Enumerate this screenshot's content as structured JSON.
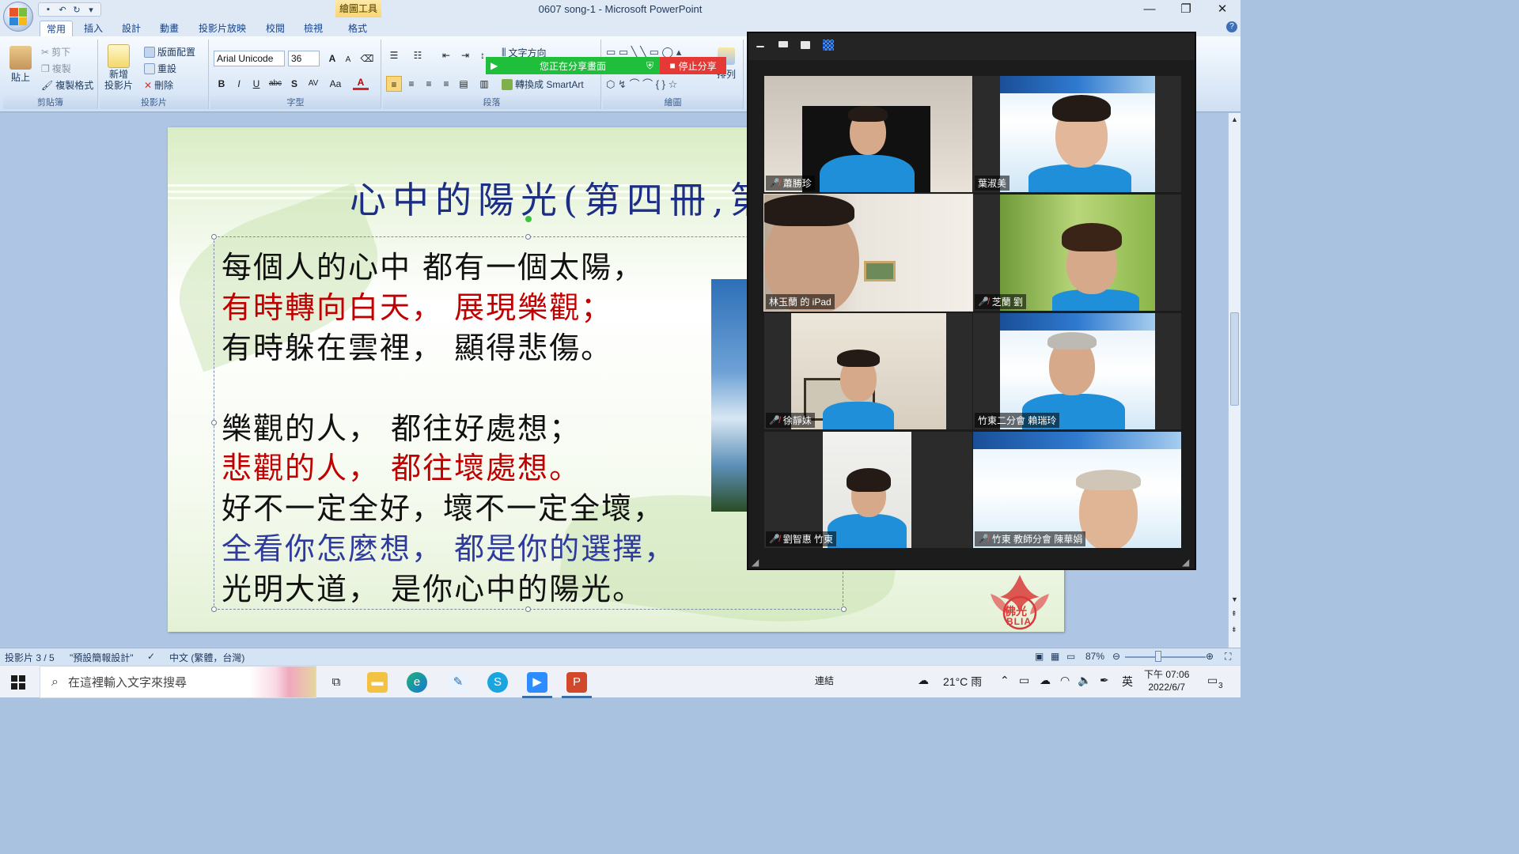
{
  "window": {
    "title": "0607 song-1 - Microsoft PowerPoint",
    "contextual_tab": "繪圖工具",
    "controls": {
      "minimize": "—",
      "restore": "❐",
      "close": "✕"
    }
  },
  "quick_access": {
    "save": "▪",
    "undo": "↶",
    "redo": "↻",
    "more": "▾"
  },
  "ribbon_tabs": [
    "常用",
    "插入",
    "設計",
    "動畫",
    "投影片放映",
    "校閱",
    "檢視",
    "格式"
  ],
  "ribbon": {
    "clipboard": {
      "paste": "貼上",
      "cut": "剪下",
      "copy": "複製",
      "format_painter": "複製格式",
      "label": "剪貼簿"
    },
    "slides": {
      "new_slide": "新增\n投影片",
      "layout": "版面配置",
      "reset": "重設",
      "delete": "刪除",
      "label": "投影片"
    },
    "font": {
      "family": "Arial Unicode",
      "size": "36",
      "label": "字型",
      "grow": "A",
      "shrink": "A",
      "clear": "⌫",
      "bold": "B",
      "italic": "I",
      "underline": "U",
      "strike": "abc",
      "shadow": "S",
      "spacing": "AV",
      "case": "Aa",
      "color": "A"
    },
    "paragraph": {
      "text_direction": "文字方向",
      "smartart": "轉換成 SmartArt",
      "label": "段落"
    },
    "drawing": {
      "arrange": "排列",
      "label": "繪圖"
    }
  },
  "share_banner": {
    "status": "您正在分享畫面",
    "stop": "停止分享"
  },
  "slide": {
    "title": "心中的陽光(第四冊,第",
    "lines": [
      {
        "text": "每個人的心中 都有一個太陽，",
        "color": "#111111"
      },
      {
        "text": "有時轉向白天， 展現樂觀；",
        "color": "#c00000"
      },
      {
        "text": "有時躲在雲裡， 顯得悲傷。",
        "color": "#111111"
      },
      {
        "text": "樂觀的人， 都往好處想；",
        "color": "#111111"
      },
      {
        "text": "悲觀的人， 都往壞處想。",
        "color": "#c00000"
      },
      {
        "text": "好不一定全好，壞不一定全壞，",
        "color": "#111111"
      },
      {
        "text": "全看你怎麼想， 都是你的選擇，",
        "color": "#2f3a9e"
      },
      {
        "text": "光明大道， 是你心中的陽光。",
        "color": "#111111"
      }
    ],
    "logo_text": "佛光",
    "logo_sub": "BLIA"
  },
  "status_bar": {
    "slide_index": "投影片 3 / 5",
    "theme": "\"預設簡報設計\"",
    "language": "中文 (繁體，台灣)",
    "zoom": "87%"
  },
  "zoom_meeting": {
    "participants": [
      {
        "name": "蕭勝珍",
        "muted": true
      },
      {
        "name": "葉淑美",
        "muted": false
      },
      {
        "name": "林玉蘭 的 iPad",
        "muted": false,
        "active": true
      },
      {
        "name": "芝蘭 劉",
        "muted": true
      },
      {
        "name": "徐靜妹",
        "muted": true
      },
      {
        "name": "竹東二分會 賴瑞玲",
        "muted": false
      },
      {
        "name": "劉智惠 竹東",
        "muted": true
      },
      {
        "name": "竹東 教師分會 陳華娟",
        "muted": true
      }
    ]
  },
  "taskbar": {
    "search_placeholder": "在這裡輸入文字來搜尋",
    "network_label": "連結",
    "weather": "21°C 雨",
    "ime": "英",
    "time": "下午 07:06",
    "date": "2022/6/7",
    "notifications": "3"
  },
  "colors": {
    "accent": "#15428b",
    "title_blue": "#1c2e86",
    "red": "#c00000",
    "share_green": "#1fbf3c",
    "share_red": "#e53935"
  }
}
